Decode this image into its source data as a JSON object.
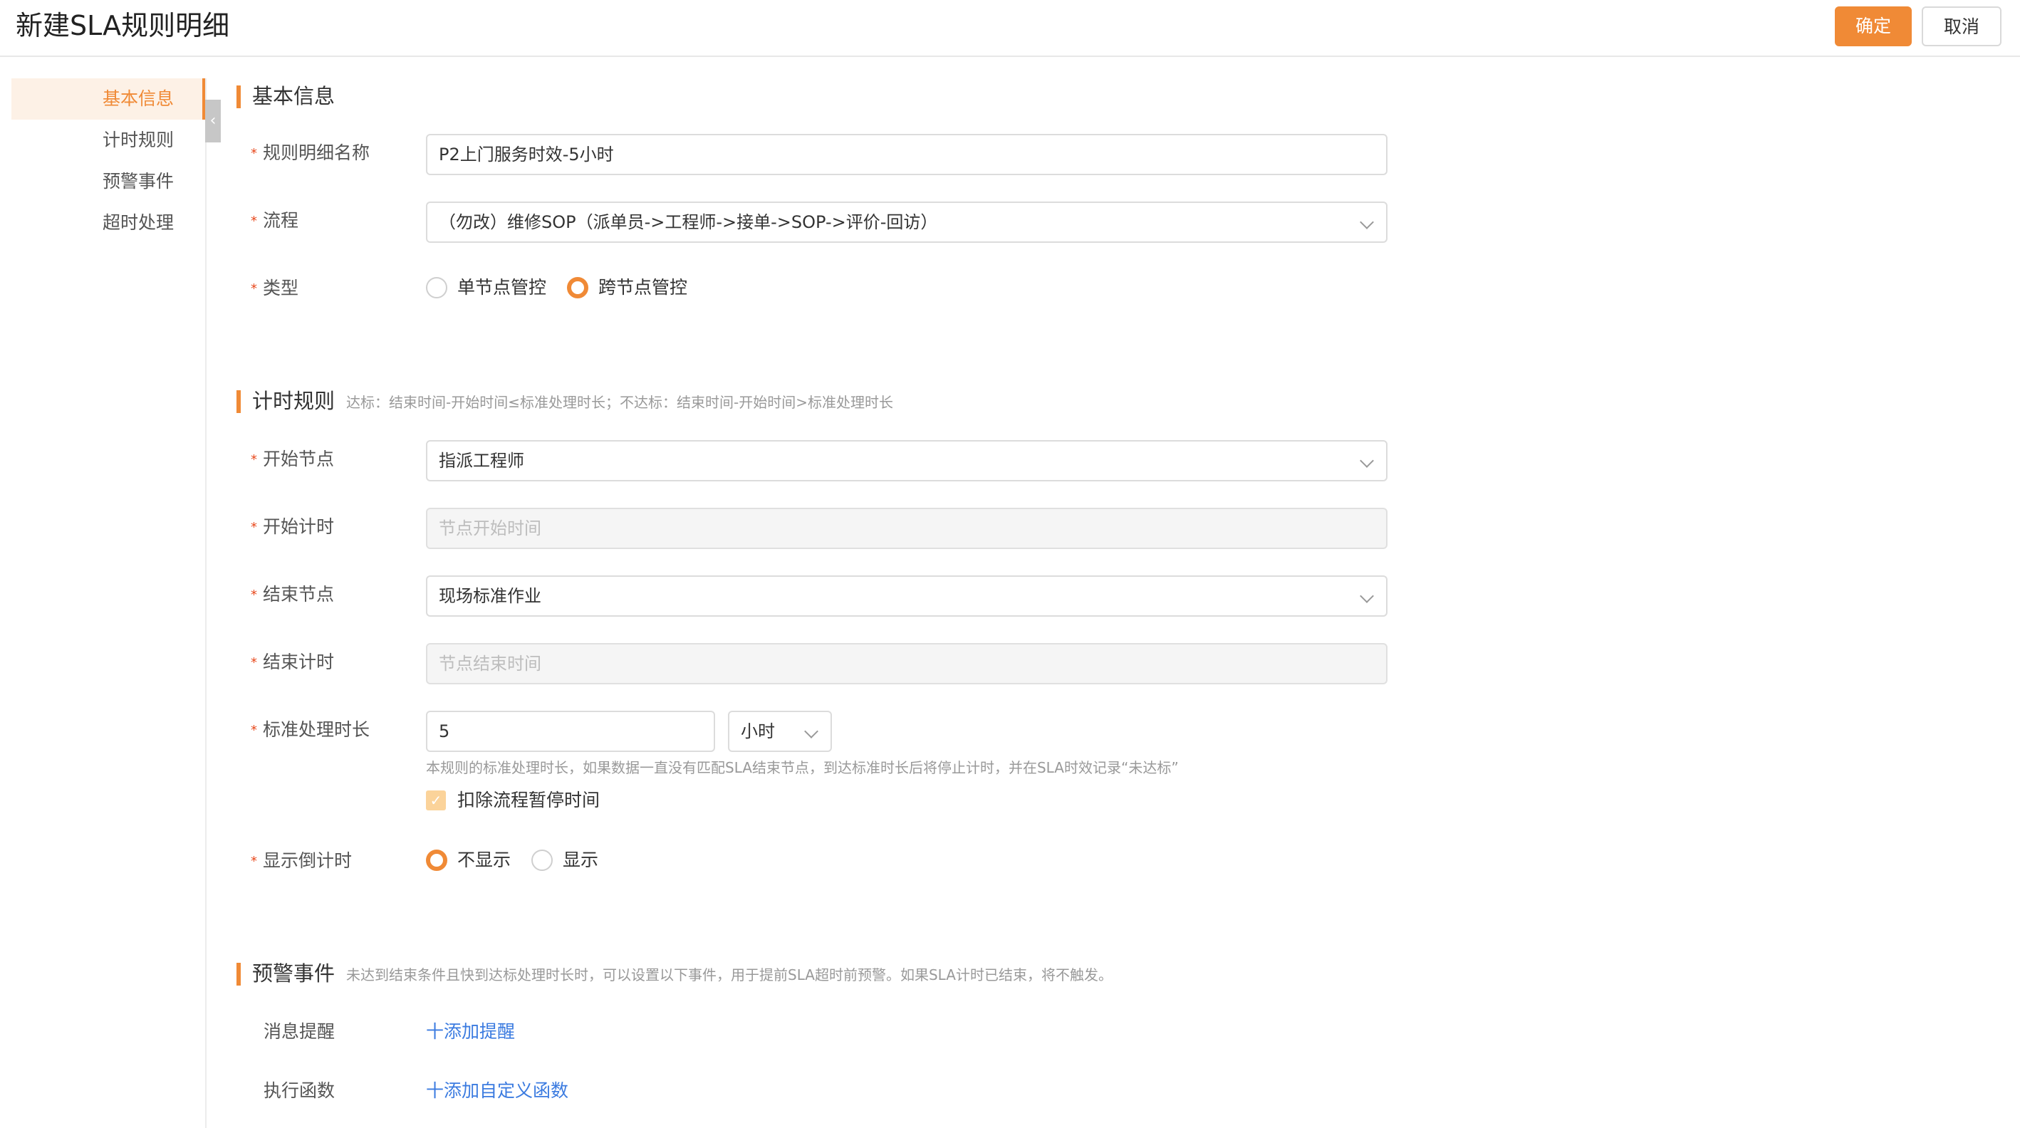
{
  "header": {
    "title": "新建SLA规则明细",
    "confirm_label": "确定",
    "cancel_label": "取消"
  },
  "sidebar": {
    "items": [
      {
        "label": "基本信息",
        "active": true
      },
      {
        "label": "计时规则",
        "active": false
      },
      {
        "label": "预警事件",
        "active": false
      },
      {
        "label": "超时处理",
        "active": false
      }
    ]
  },
  "basic_info": {
    "section_title": "基本信息",
    "name_label": "规则明细名称",
    "name_value": "P2上门服务时效-5小时",
    "flow_label": "流程",
    "flow_value": "（勿改）维修SOP（派单员->工程师->接单->SOP->评价-回访）",
    "type_label": "类型",
    "type_options": [
      "单节点管控",
      "跨节点管控"
    ],
    "type_selected": "跨节点管控"
  },
  "timing_rules": {
    "section_title": "计时规则",
    "hint": "达标：结束时间-开始时间≤标准处理时长；不达标：结束时间-开始时间>标准处理时长",
    "start_node_label": "开始节点",
    "start_node_value": "指派工程师",
    "start_timing_label": "开始计时",
    "start_timing_placeholder": "节点开始时间",
    "end_node_label": "结束节点",
    "end_node_value": "现场标准作业",
    "end_timing_label": "结束计时",
    "end_timing_placeholder": "节点结束时间",
    "duration_label": "标准处理时长",
    "duration_value": "5",
    "duration_unit": "小时",
    "duration_help": "本规则的标准处理时长，如果数据一直没有匹配SLA结束节点，到达标准时长后将停止计时，并在SLA时效记录“未达标”",
    "exclude_pause_label": "扣除流程暂停时间",
    "exclude_pause_checked": true,
    "countdown_label": "显示倒计时",
    "countdown_options": [
      "不显示",
      "显示"
    ],
    "countdown_selected": "不显示"
  },
  "warning_events": {
    "section_title": "预警事件",
    "hint": "未达到结束条件且快到达标处理时长时，可以设置以下事件，用于提前SLA超时前预警。如果SLA计时已结束，将不触发。",
    "message_label": "消息提醒",
    "message_link": "十添加提醒",
    "function_label": "执行函数",
    "function_link": "十添加自定义函数"
  },
  "colors": {
    "accent": "#f08a36",
    "link": "#3b7be0",
    "required": "#e8491d"
  }
}
